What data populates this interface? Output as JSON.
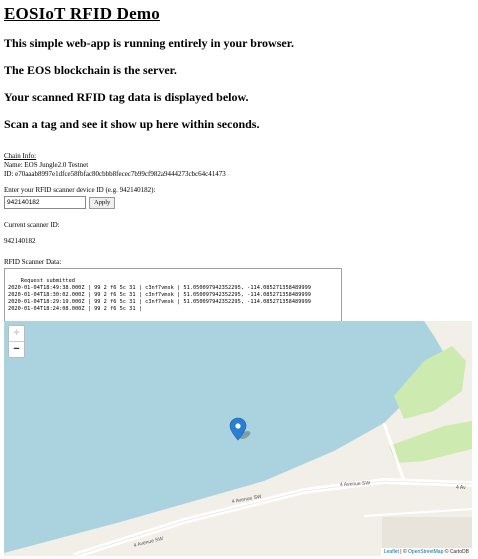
{
  "page": {
    "title": "EOSIoT RFID Demo",
    "intro": [
      "This simple web-app is running entirely in your browser.",
      "The EOS blockchain is the server.",
      "Your scanned RFID tag data is displayed below.",
      "Scan a tag and see it show up here within seconds."
    ]
  },
  "chain": {
    "title": "Chain Info:",
    "name_line": "Name: EOS Jungle2.0 Testnet",
    "id_line": "ID: e70aaab8997e1dfce58fbfac80cbbb8fecec7b99cf982a9444273cbc64c41473"
  },
  "device": {
    "label": "Enter your RFID scanner device ID (e.g. 942140182):",
    "input_value": "942140182",
    "apply_label": "Apply"
  },
  "scanner": {
    "current_label": "Current scanner ID:",
    "current_value": "942140182"
  },
  "rfid": {
    "label": "RFID Scanner Data:",
    "log": "Request submitted\n2020-01-04T18:49:38.000Z | 99 2 f6 5c 31 | c3nf7vmsk | 51.050097942352295, -114.085271358489999\n2020-01-04T18:30:02.000Z | 99 2 f6 5c 31 | c3nf7vmsk | 51.050097942352295, -114.085271358489999\n2020-01-04T18:29:19.000Z | 99 2 f6 5c 31 | c3nf7vmsk | 51.050097942352295, -114.085271358489999\n2020-01-04T18:24:08.000Z | 99 2 f6 5c 31 |"
  },
  "map": {
    "zoom_in": "+",
    "zoom_out": "−",
    "street_labels": [
      "4 Avenue SW",
      "4 Avenue SW",
      "4 Avenue SW",
      "4 Av"
    ],
    "attribution_leaflet": "Leaflet",
    "attribution_sep": " | © ",
    "attribution_osm": "OpenStreetMap",
    "attribution_tail": " © CartoDB",
    "colors": {
      "water": "#aad3df",
      "land": "#f2efe9",
      "park": "#cdebb0",
      "marker": "#2a7fd4"
    }
  }
}
